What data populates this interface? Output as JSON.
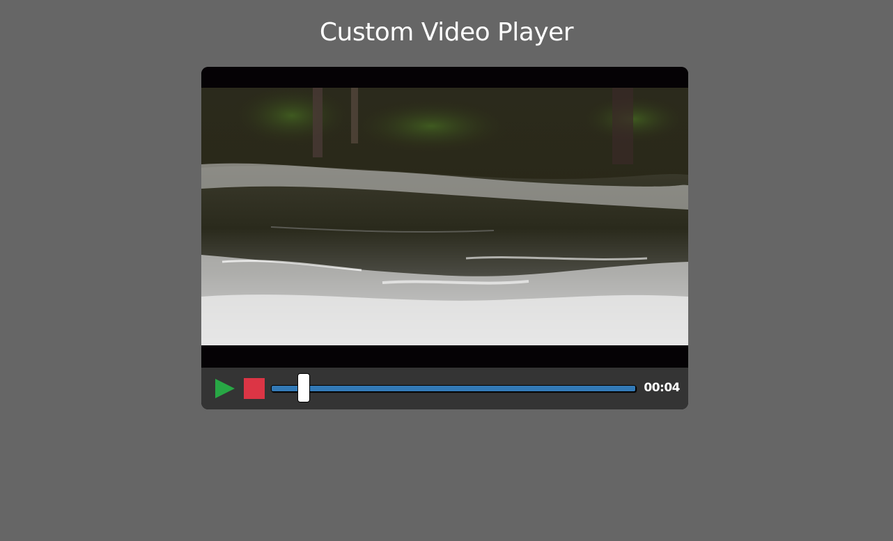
{
  "page": {
    "title": "Custom Video Player"
  },
  "player": {
    "video_scene": "river-rapids",
    "controls": {
      "play_icon": "play-icon",
      "stop_icon": "stop-icon",
      "progress_fraction": 0.09,
      "current_time": "00:04"
    },
    "colors": {
      "play": "#28a745",
      "stop": "#dc3545",
      "progress_track": "#337ab7",
      "controls_bg": "#343434",
      "page_bg": "#666666"
    }
  }
}
